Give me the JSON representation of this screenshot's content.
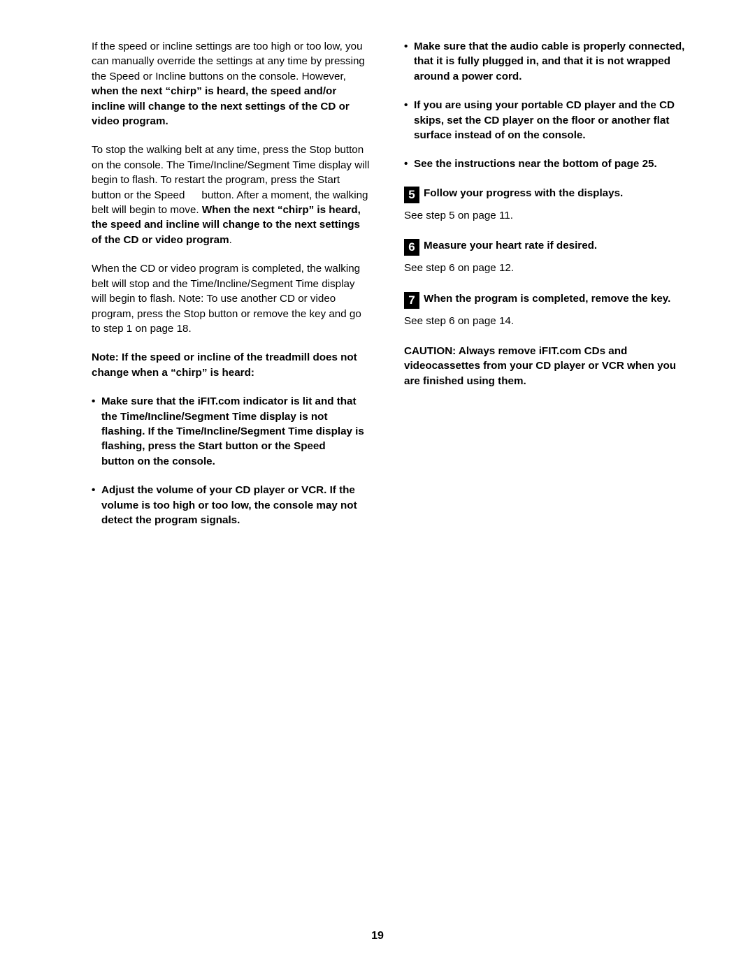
{
  "page_number": "19",
  "left_column": {
    "para1_part1": "If the speed or incline settings are too high or too low, you can manually override the settings at any time by pressing the Speed or Incline buttons on the console. However, ",
    "para1_bold": "when the next “chirp” is heard, the speed and/or incline will change to the next settings of the CD or video program.",
    "para2_part1": "To stop the walking belt at any time, press the Stop button on the console. The Time/Incline/Segment Time display will begin to flash. To restart the program, press the Start button or the Speed",
    "para2_part2": "button. After a moment, the walking belt will begin to move. ",
    "para2_bold": "When the next “chirp” is heard, the speed and incline will change to the next settings of the CD or video program",
    "para2_end": ".",
    "para3": "When the CD or video program is completed, the walking belt will stop and the Time/Incline/Segment Time display will begin to flash. Note: To use another CD or video program, press the Stop button or remove the key and go to step 1 on page 18.",
    "note": "Note: If the speed or incline of the treadmill does not change when a “chirp” is heard:",
    "bullet1_a": "Make sure that the iFIT.com indicator is lit and that the Time/Incline/Segment Time display is not flashing. If the Time/Incline/Segment Time display is flashing, press the Start button or the Speed",
    "bullet1_b": "button on the console.",
    "bullet2": "Adjust the volume of your CD player or VCR. If the volume is too high or too low, the console may not detect the program signals."
  },
  "right_column": {
    "bullet1": "Make sure that the audio cable is properly connected, that it is fully plugged in, and that it is not wrapped around a power cord.",
    "bullet2": "If you are using your portable CD player and the CD skips, set the CD player on the floor or another flat surface instead of on the console.",
    "bullet3": "See the instructions near the bottom of page 25.",
    "step5_num": "5",
    "step5_text": "Follow your progress with the displays.",
    "step5_see": "See step 5 on page 11.",
    "step6_num": "6",
    "step6_text": "Measure your heart rate if desired.",
    "step6_see": "See step 6 on page 12.",
    "step7_num": "7",
    "step7_text": "When the program is completed, remove the key.",
    "step7_see": "See step 6 on page 14.",
    "caution": "CAUTION: Always remove iFIT.com CDs and videocassettes from your CD player or VCR when you are finished using them."
  },
  "bullet_marker": "•"
}
